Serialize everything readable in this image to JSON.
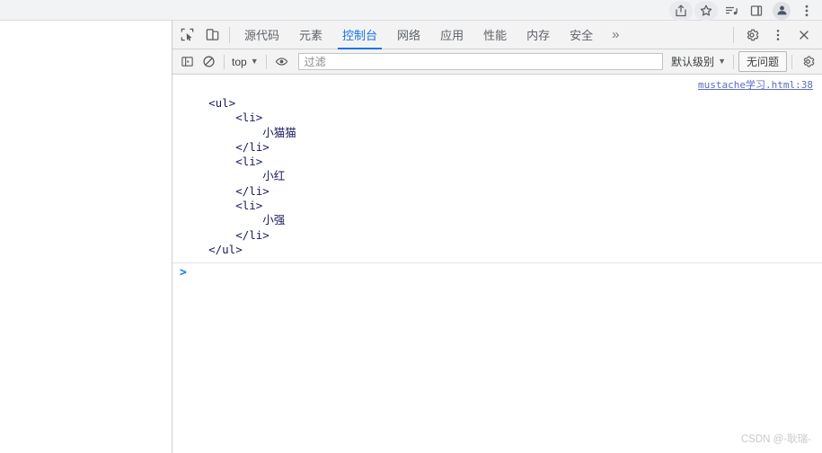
{
  "browser": {
    "actions": [
      {
        "name": "share-icon",
        "label": "分享"
      },
      {
        "name": "bookmark-star-icon",
        "label": "收藏"
      },
      {
        "name": "reading-list-icon",
        "label": "阅读清单"
      },
      {
        "name": "side-panel-icon",
        "label": "侧边栏"
      },
      {
        "name": "profile-avatar",
        "label": "个人资料"
      },
      {
        "name": "browser-menu-icon",
        "label": "自定义及控制"
      }
    ]
  },
  "devtools": {
    "left_tools": [
      {
        "name": "inspect-element-icon",
        "label": "检查元素"
      },
      {
        "name": "device-toolbar-icon",
        "label": "设备工具栏"
      }
    ],
    "tabs": [
      {
        "label": "源代码",
        "active": false
      },
      {
        "label": "元素",
        "active": false
      },
      {
        "label": "控制台",
        "active": true
      },
      {
        "label": "网络",
        "active": false
      },
      {
        "label": "应用",
        "active": false
      },
      {
        "label": "性能",
        "active": false
      },
      {
        "label": "内存",
        "active": false
      },
      {
        "label": "安全",
        "active": false
      }
    ],
    "more_tabs_label": "»",
    "right_tools": [
      {
        "name": "settings-gear-icon",
        "label": "设置"
      },
      {
        "name": "devtools-menu-icon",
        "label": "更多选项"
      },
      {
        "name": "close-devtools-icon",
        "label": "关闭"
      }
    ],
    "console_toolbar": {
      "sidebar_toggle_label": "控制台边栏",
      "clear_console_label": "清除控制台",
      "context_selector": "top",
      "eye_label": "实时表达式",
      "filter_placeholder": "过滤",
      "filter_value": "",
      "level_selector": "默认级别",
      "issues_button": "无问题",
      "settings_label": "控制台设置"
    },
    "console": {
      "source_link": "mustache学习.html:38",
      "output_lines": [
        "    <ul>",
        "        <li>",
        "            小猫猫",
        "        </li>",
        "        <li>",
        "            小红",
        "        </li>",
        "        <li>",
        "            小强",
        "        </li>",
        "    </ul>"
      ],
      "prompt_symbol": ">",
      "prompt_value": ""
    }
  },
  "watermark": "CSDN @-耿瑞-"
}
